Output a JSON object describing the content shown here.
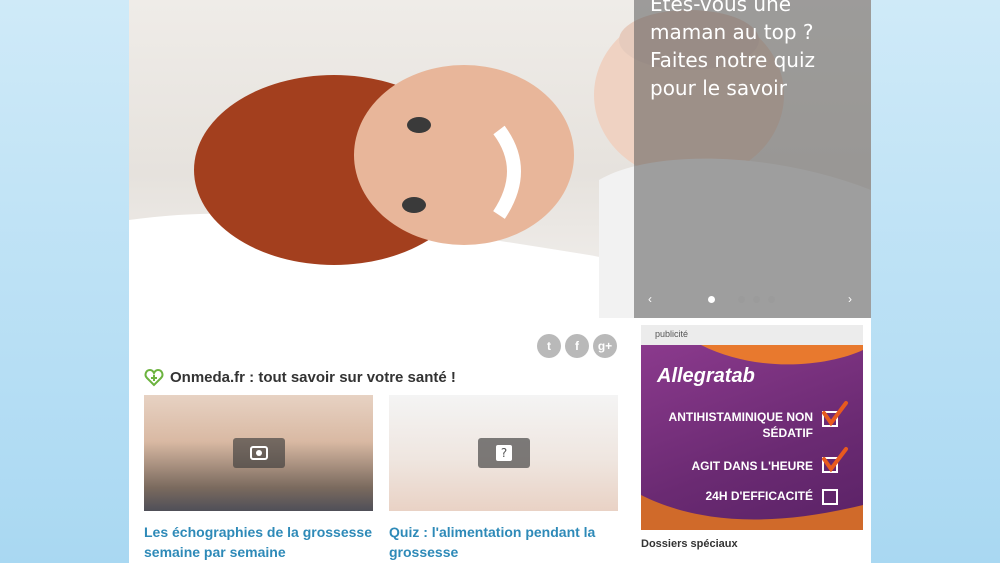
{
  "hero": {
    "headline": "Êtes-vous une maman au top ? Faites notre quiz pour le savoir",
    "slides_count": 4,
    "active_slide": 1
  },
  "social": {
    "twitter": "t",
    "facebook": "f",
    "googleplus": "g+"
  },
  "section": {
    "title": "Onmeda.fr : tout savoir sur votre santé !"
  },
  "cards": [
    {
      "title": "Les échographies de la grossesse semaine par semaine",
      "icon": "camera-icon"
    },
    {
      "title": "Quiz : l'alimentation pendant la grossesse",
      "icon": "quiz-icon"
    }
  ],
  "ad": {
    "label": "publicité",
    "brand": "Allegratab",
    "lines": [
      "ANTIHISTAMINIQUE NON SÉDATIF",
      "AGIT DANS L'HEURE",
      "24H D'EFFICACITÉ"
    ],
    "checked": [
      true,
      true,
      false
    ]
  },
  "sidebar": {
    "dossiers_title": "Dossiers spéciaux"
  },
  "colors": {
    "link": "#2e8ab8",
    "background": "#bfe3f6",
    "logo_green": "#6cb33f"
  }
}
